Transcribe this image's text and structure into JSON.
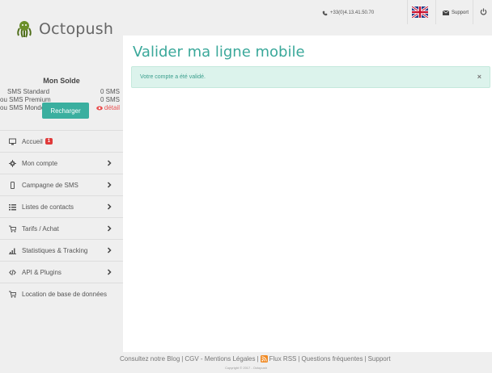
{
  "header": {
    "logo_text": "Octopush",
    "phone": "+33(0)4.13.41.50.70",
    "support_label": "Support"
  },
  "sidebar": {
    "solde_title": "Mon Solde",
    "balances": [
      {
        "label": "SMS Standard",
        "value": "0 SMS"
      },
      {
        "label": "ou SMS Premium",
        "value": "0 SMS"
      },
      {
        "label": "ou SMS Monde",
        "value": "détail"
      }
    ],
    "recharge_label": "Recharger",
    "menu": [
      {
        "label": "Accueil",
        "icon": "monitor-icon",
        "badge": "1",
        "chevron": false
      },
      {
        "label": "Mon compte",
        "icon": "gear-icon",
        "chevron": true
      },
      {
        "label": "Campagne de SMS",
        "icon": "mobile-icon",
        "chevron": true
      },
      {
        "label": "Listes de contacts",
        "icon": "list-icon",
        "chevron": true
      },
      {
        "label": "Tarifs / Achat",
        "icon": "cart-icon",
        "chevron": true
      },
      {
        "label": "Statistiques & Tracking",
        "icon": "bar-chart-icon",
        "chevron": true
      },
      {
        "label": "API & Plugins",
        "icon": "code-icon",
        "chevron": true
      },
      {
        "label": "Location de base de données",
        "icon": "cart-icon",
        "chevron": false
      }
    ]
  },
  "main": {
    "title": "Valider ma ligne mobile",
    "alert_text": "Votre compte a été validé.",
    "alert_close": "×"
  },
  "footer": {
    "links": [
      "Consultez notre Blog",
      "CGV - Mentions Légales",
      "Flux RSS",
      "Questions fréquentes",
      "Support"
    ],
    "separator": "|",
    "copyright": "Copyright © 2017 - Octopush"
  },
  "colors": {
    "accent": "#3aaf9f",
    "alert_bg": "#dcf3ec",
    "badge": "#e03a3a",
    "rss": "#f08a24"
  }
}
